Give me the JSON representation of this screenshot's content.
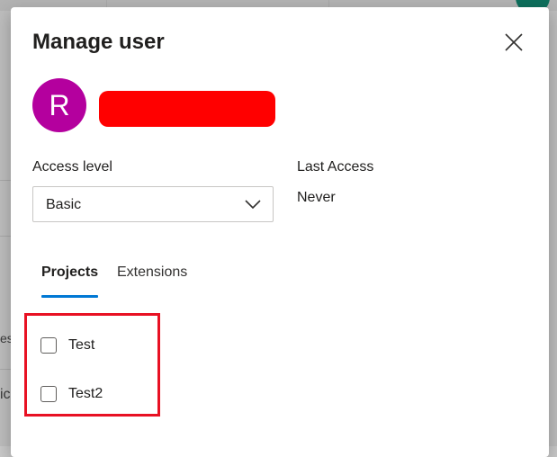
{
  "background": {
    "fragment_1": "es",
    "fragment_2": "ic"
  },
  "dialog": {
    "title": "Manage user",
    "close_icon": "close-icon",
    "user": {
      "avatar_initial": "R",
      "avatar_color": "#b4009e",
      "name_redacted": true,
      "redaction_color": "#ff0000"
    },
    "access_level": {
      "label": "Access level",
      "value": "Basic",
      "chevron_icon": "chevron-down-icon"
    },
    "last_access": {
      "label": "Last Access",
      "value": "Never"
    },
    "tabs": [
      {
        "label": "Projects",
        "selected": true
      },
      {
        "label": "Extensions",
        "selected": false
      }
    ],
    "accent_color": "#0078d4",
    "projects": [
      {
        "label": "Test",
        "checked": false
      },
      {
        "label": "Test2",
        "checked": false
      }
    ],
    "annotation_color": "#e81123"
  }
}
